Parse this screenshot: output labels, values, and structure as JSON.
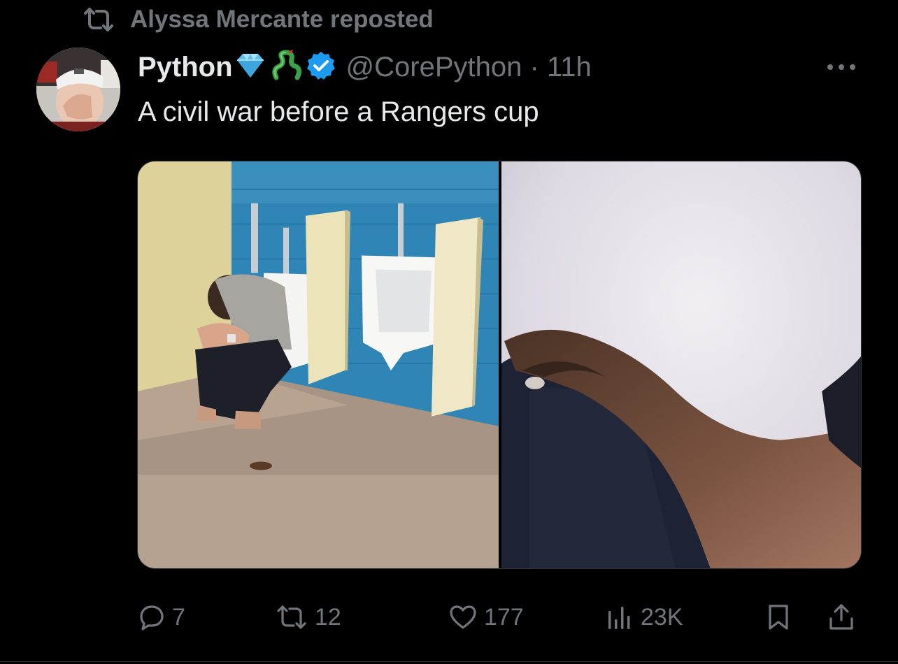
{
  "repost": {
    "label": "Alyssa Mercante reposted"
  },
  "author": {
    "name": "Python",
    "handle": "@CorePython",
    "separator": "·",
    "time": "11h"
  },
  "icons": {
    "repost": "repost-icon",
    "verified": "verified-badge-icon",
    "diamond": "diamond-emoji-icon",
    "snake": "snake-emoji-icon",
    "more": "more-options-icon",
    "reply": "reply-icon",
    "like": "like-icon",
    "views": "views-icon",
    "bookmark": "bookmark-icon",
    "share": "share-icon"
  },
  "tweet": {
    "text": "A civil war before a Rangers cup"
  },
  "media": [
    {
      "name": "photo-1"
    },
    {
      "name": "photo-2"
    }
  ],
  "actions": {
    "replies": "7",
    "reposts": "12",
    "likes": "177",
    "views": "23K"
  },
  "colors": {
    "background": "#000000",
    "text": "#e7e9ea",
    "muted": "#71767b",
    "verified": "#1d9bf0",
    "snake": "#3aa34a",
    "diamond": "#5bc2f2"
  }
}
